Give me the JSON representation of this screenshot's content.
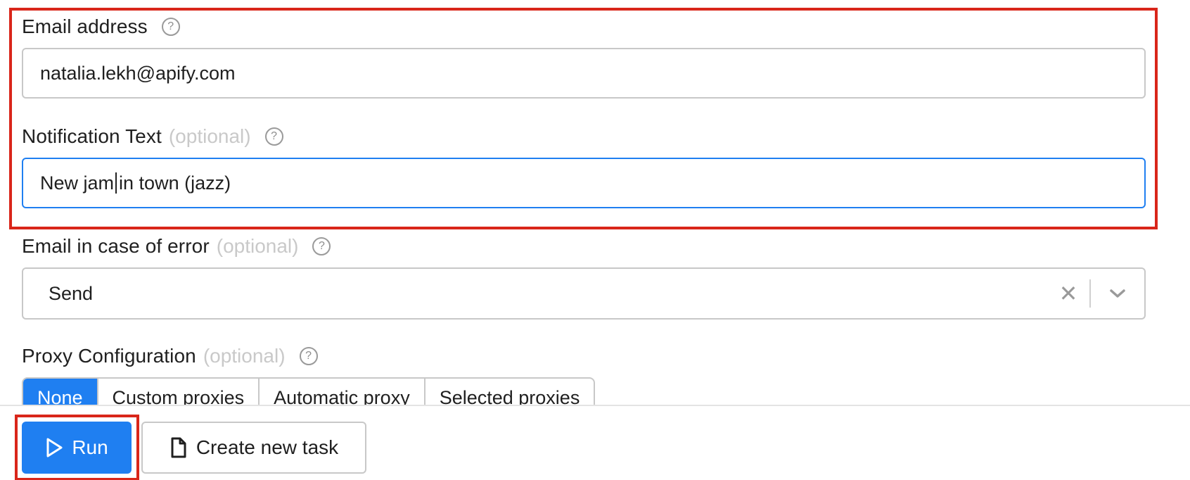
{
  "form": {
    "email": {
      "label": "Email address",
      "help": "?",
      "value": "natalia.lekh@apify.com"
    },
    "notification": {
      "label": "Notification Text",
      "optional": "(optional)",
      "help": "?",
      "value_before_caret": "New jam",
      "value_after_caret": "in town (jazz)"
    },
    "error_email": {
      "label": "Email in case of error",
      "optional": "(optional)",
      "help": "?",
      "selected": "Send",
      "clear": "✕"
    },
    "proxy": {
      "label": "Proxy Configuration",
      "optional": "(optional)",
      "help": "?",
      "options": [
        "None",
        "Custom proxies",
        "Automatic proxy",
        "Selected proxies"
      ],
      "selected": "None"
    }
  },
  "actions": {
    "run_label": "Run",
    "create_task_label": "Create new task"
  },
  "icons": {
    "run": "play-icon",
    "create_task": "document-icon",
    "select_arrow": "chevron-down-icon",
    "help": "help-circle-icon"
  },
  "colors": {
    "accent": "#1f7ff1",
    "highlight": "#d9261a"
  }
}
